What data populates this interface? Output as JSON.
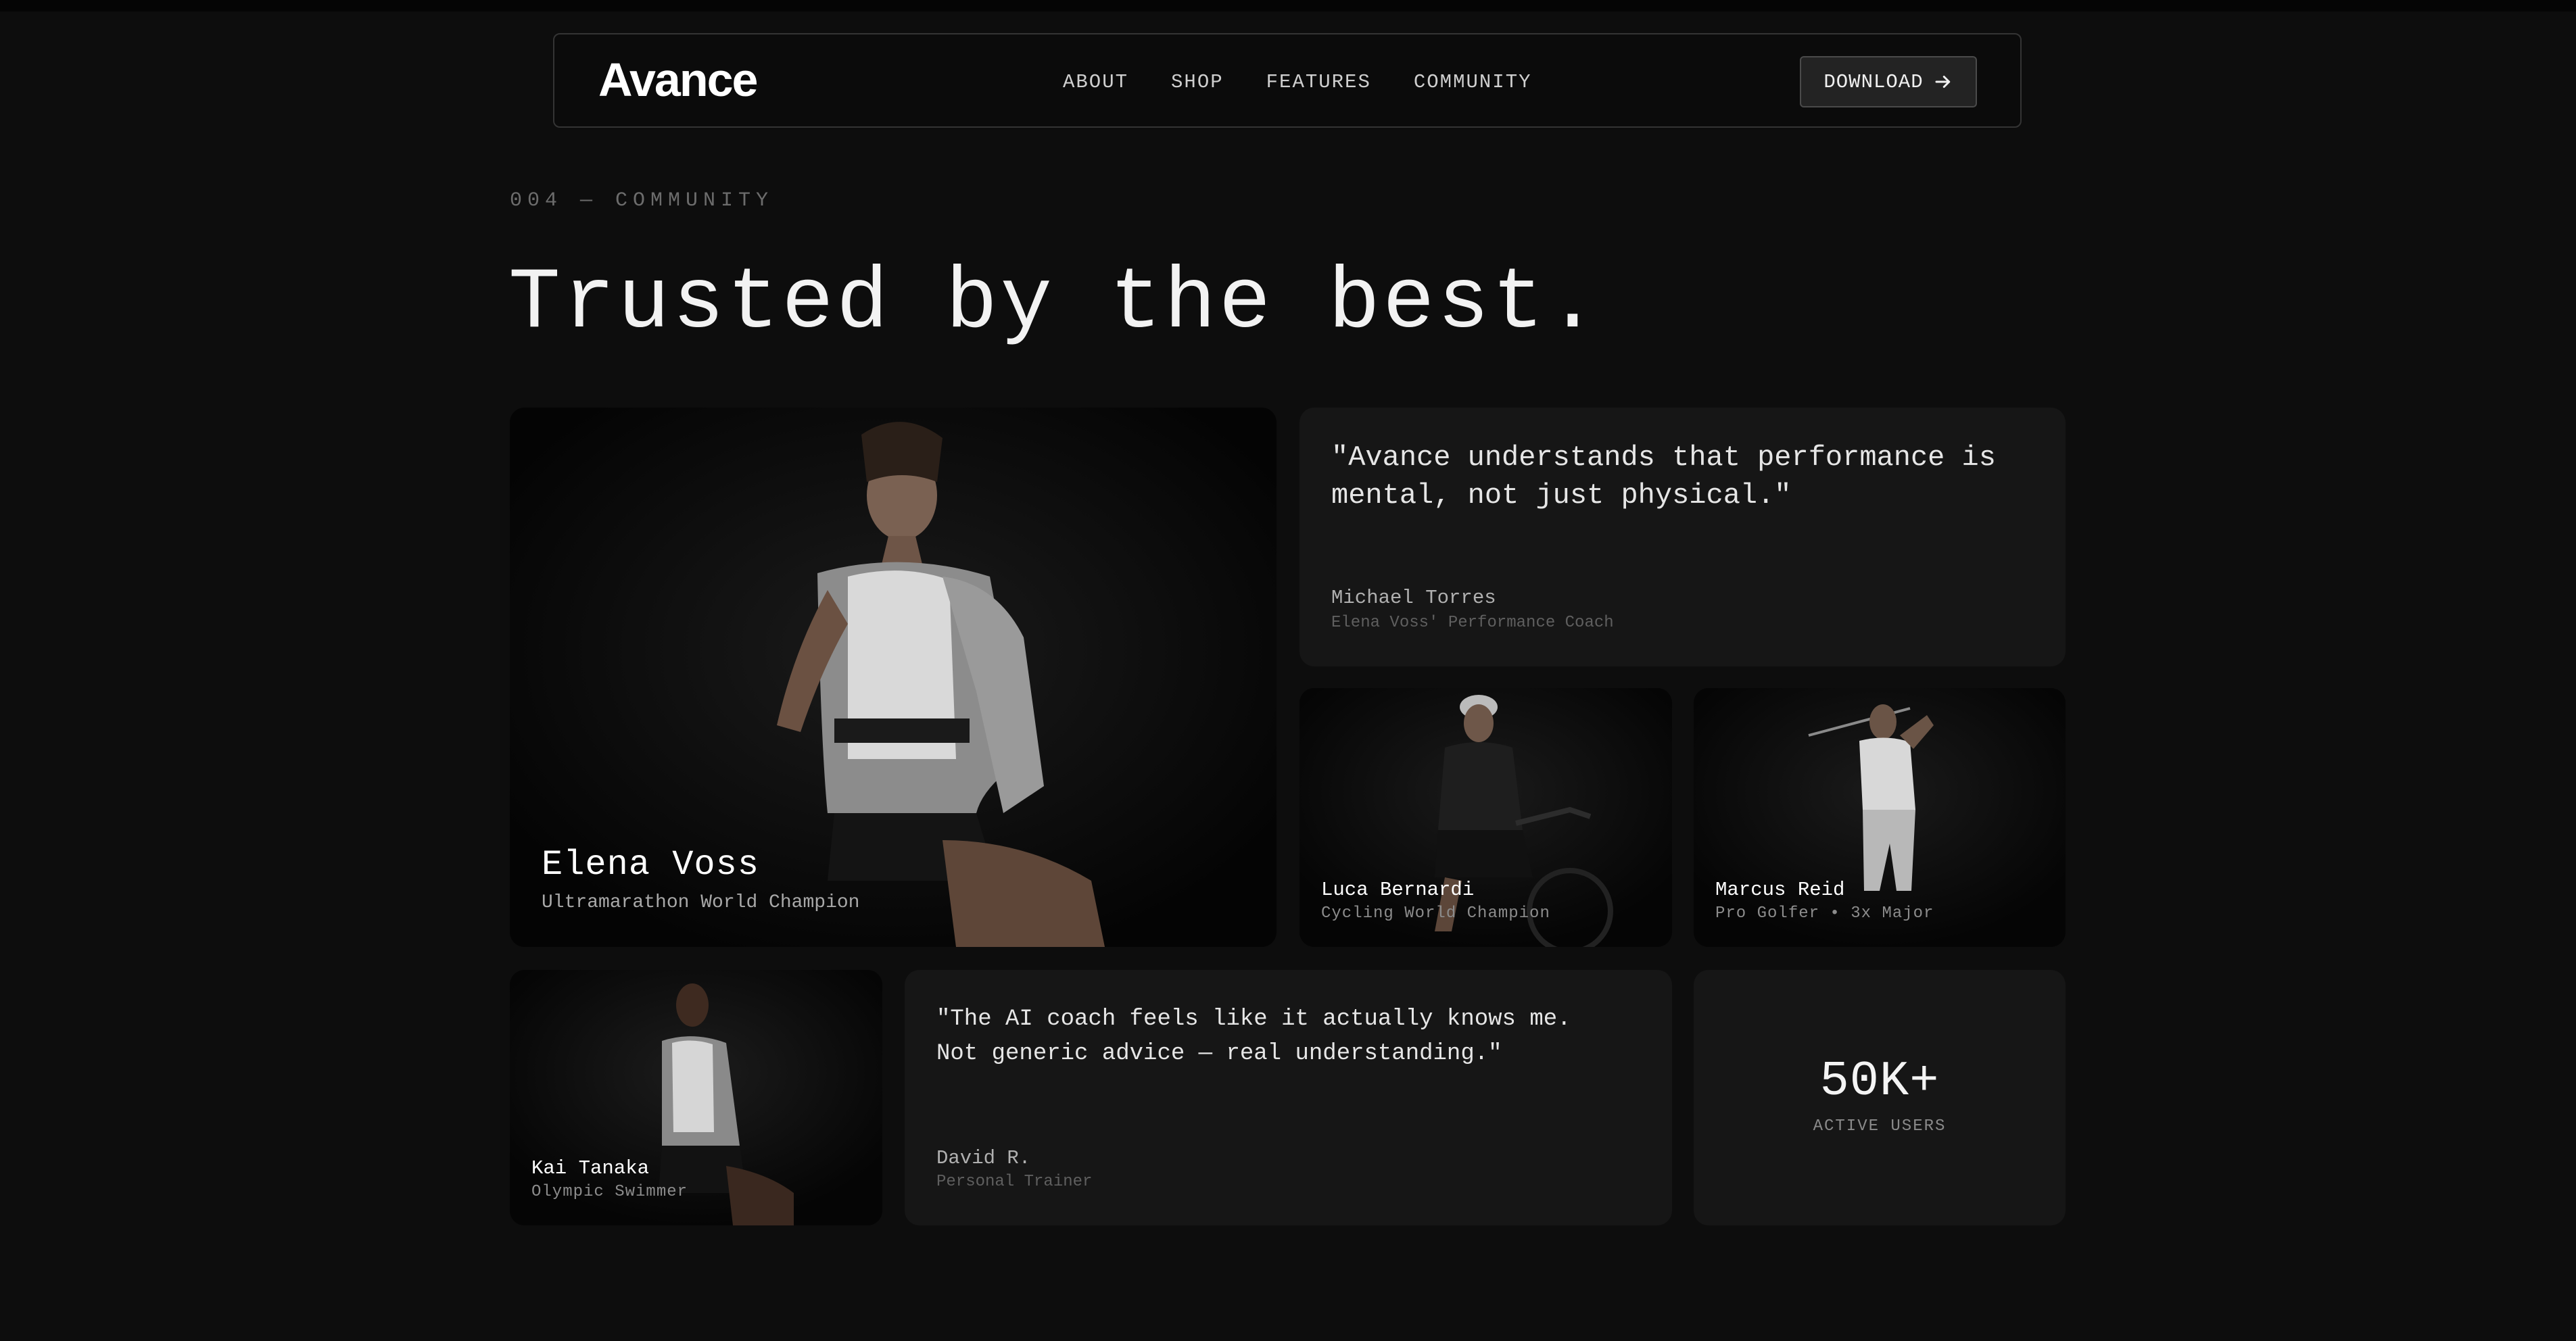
{
  "nav": {
    "logo": "Avance",
    "links": [
      "ABOUT",
      "SHOP",
      "FEATURES",
      "COMMUNITY"
    ],
    "download_label": "DOWNLOAD"
  },
  "section": {
    "eyebrow": "004 — COMMUNITY",
    "title": "Trusted by the best."
  },
  "athletes": [
    {
      "name": "Elena Voss",
      "role": "Ultramarathon World Champion"
    },
    {
      "name": "Luca Bernardi",
      "role": "Cycling World Champion"
    },
    {
      "name": "Marcus Reid",
      "role": "Pro Golfer • 3x Major"
    },
    {
      "name": "Kai Tanaka",
      "role": "Olympic Swimmer"
    }
  ],
  "quotes": [
    {
      "text": "\"Avance understands that performance is mental, not just physical.\"",
      "author": "Michael Torres",
      "role": "Elena Voss' Performance Coach"
    },
    {
      "text": "\"The AI coach feels like it actually knows me. Not generic advice — real understanding.\"",
      "author": "David R.",
      "role": "Personal Trainer"
    }
  ],
  "stat": {
    "value": "50K+",
    "label": "ACTIVE USERS"
  },
  "icons": {
    "download_arrow": "arrow-right-icon"
  },
  "colors": {
    "background": "#0d0d0d",
    "card": "#161616",
    "text": "#f2f2f2",
    "muted": "#6c6c6c"
  }
}
